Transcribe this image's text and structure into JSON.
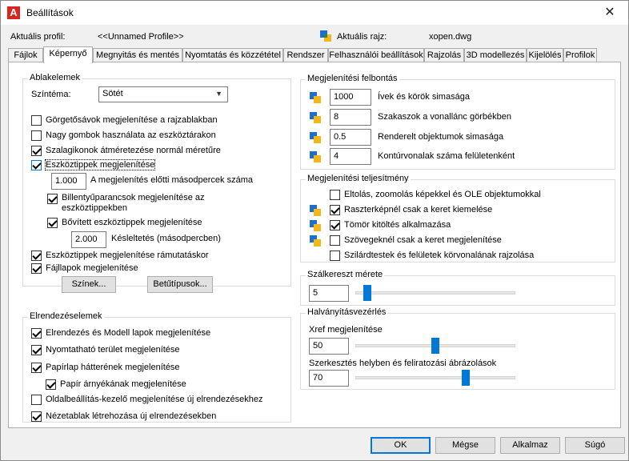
{
  "window": {
    "title": "Beállítások",
    "logo_letter": "A"
  },
  "profile": {
    "current_profile_label": "Aktuális profil:",
    "current_profile_value": "<<Unnamed Profile>>",
    "current_drawing_label": "Aktuális rajz:",
    "current_drawing_value": "xopen.dwg"
  },
  "tabs": [
    "Fájlok",
    "Képernyő",
    "Megnyitás és mentés",
    "Nyomtatás és közzététel",
    "Rendszer",
    "Felhasználói beállítások",
    "Rajzolás",
    "3D modellezés",
    "Kijelölés",
    "Profilok"
  ],
  "active_tab": "Képernyő",
  "window_elements": {
    "title": "Ablakelemek",
    "color_scheme_label": "Színtéma:",
    "color_scheme_value": "Sötét",
    "scrollbars": "Görgetősávok megjelenítése a rajzablakban",
    "large_buttons": "Nagy gombok használata az eszköztárakon",
    "resize_ribbon": "Szalagikonok átméretezése normál méretűre",
    "show_tooltips": "Eszköztippek megjelenítése",
    "tooltip_delay_value": "1.000",
    "tooltip_delay_label": "A megjelenítés előtti másodpercek száma",
    "shortcut_keys": "Billentyűparancsok megjelenítése az eszköztippekben",
    "extended_tooltips": "Bővített eszköztippek megjelenítése",
    "extended_delay_value": "2.000",
    "extended_delay_label": "Késleltetés (másodpercben)",
    "rollover_tooltips": "Eszköztippek megjelenítése rámutatáskor",
    "file_tabs": "Fájllapok megjelenítése",
    "colors_button": "Színek...",
    "fonts_button": "Betűtípusok..."
  },
  "layout_elements": {
    "title": "Elrendezéselemek",
    "layout_model_tabs": "Elrendezés és Modell lapok megjelenítése",
    "printable_area": "Nyomtatható terület megjelenítése",
    "paper_background": "Papírlap hátterének megjelenítése",
    "paper_shadow": "Papír árnyékának megjelenítése",
    "page_setup_manager": "Oldalbeállítás-kezelő megjelenítése új elrendezésekhez",
    "create_viewport": "Nézetablak létrehozása új elrendezésekben"
  },
  "display_resolution": {
    "title": "Megjelenítési felbontás",
    "arc_value": "1000",
    "arc_label": "Ívek és körök simasága",
    "polyline_value": "8",
    "polyline_label": "Szakaszok a vonallánc görbékben",
    "render_value": "0.5",
    "render_label": "Renderelt objektumok simasága",
    "contour_value": "4",
    "contour_label": "Kontúrvonalak száma felületenként"
  },
  "display_performance": {
    "title": "Megjelenítési teljesítmény",
    "pan_zoom": "Eltolás, zoomolás képekkel és OLE objektumokkal",
    "raster_frame": "Raszterképnél csak a keret kiemelése",
    "solid_fill": "Tömör kitöltés alkalmazása",
    "text_frame": "Szövegeknél csak a keret megjelenítése",
    "silhouettes": "Szilárdtestek és felületek körvonalának rajzolása"
  },
  "crosshair": {
    "title": "Szálkereszt mérete",
    "value": "5",
    "slider_percent": 5
  },
  "fade_control": {
    "title": "Halványításvezérlés",
    "xref_label": "Xref megjelenítése",
    "xref_value": "50",
    "xref_slider_percent": 50,
    "inplace_label": "Szerkesztés helyben és feliratozási ábrázolások",
    "inplace_value": "70",
    "inplace_slider_percent": 70
  },
  "buttons": {
    "ok": "OK",
    "cancel": "Mégse",
    "apply": "Alkalmaz",
    "help": "Súgó"
  },
  "colors": {
    "accent": "#0078d7",
    "logo_red": "#d8261f"
  }
}
